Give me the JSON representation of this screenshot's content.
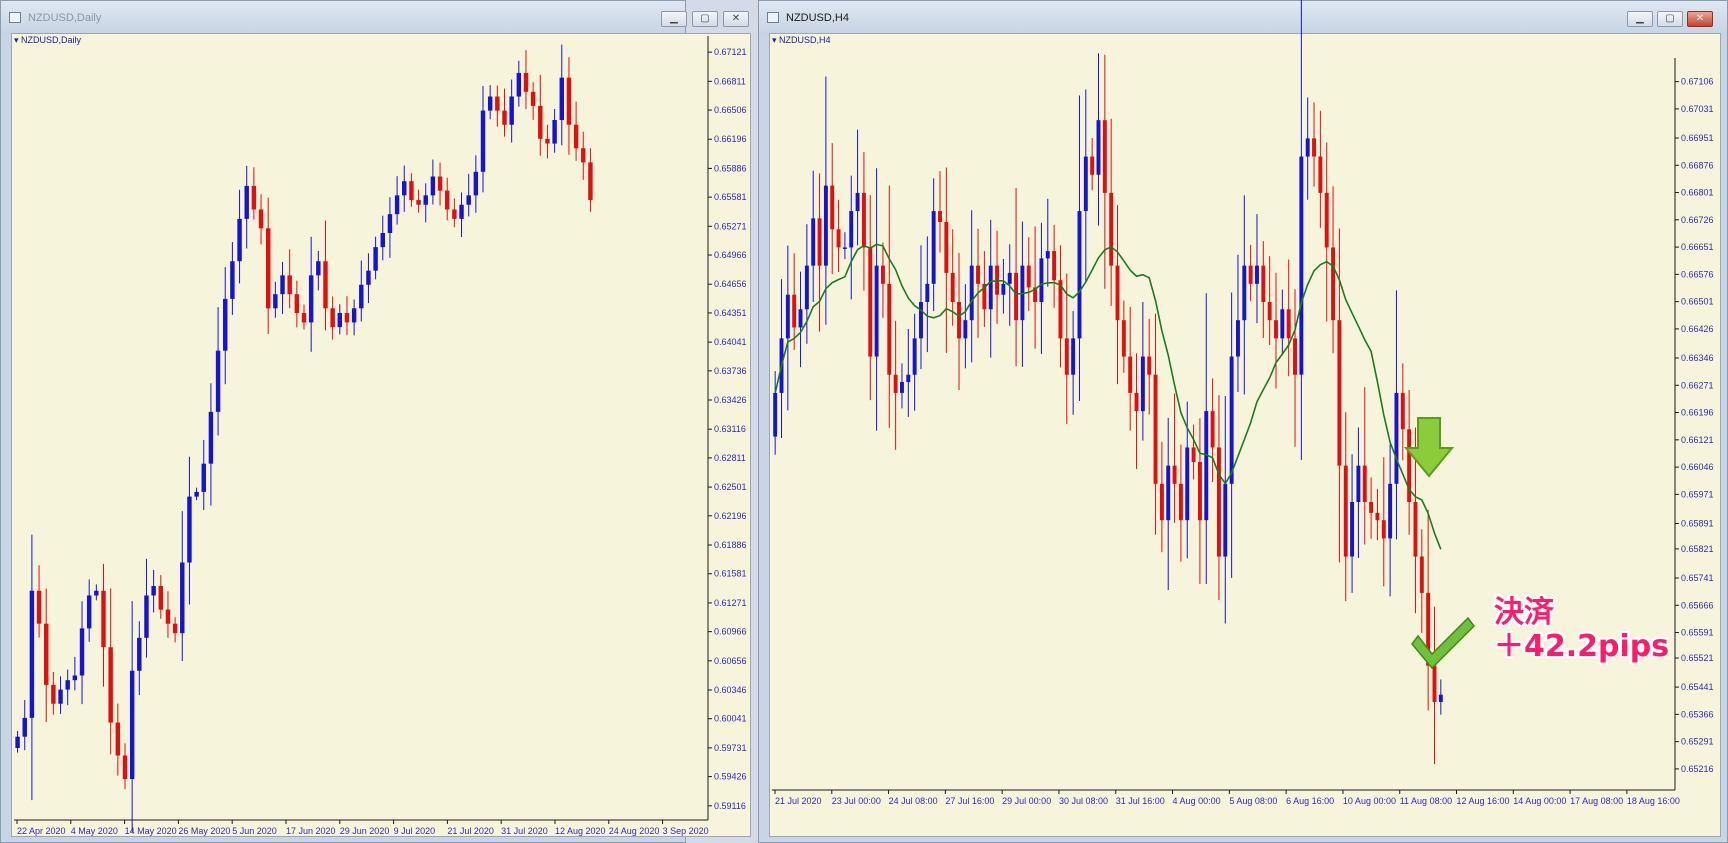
{
  "colors": {
    "bull": "#1515d0",
    "bear": "#e01010",
    "ma": "#1e7a1e",
    "axis_text": "#2b2bb8",
    "bg": "#f7f4dc"
  },
  "left_window": {
    "title": "NZDUSD,Daily",
    "chart_label": "NZDUSD,Daily",
    "controls": [
      "minimize",
      "maximize",
      "close"
    ]
  },
  "right_window": {
    "title": "NZDUSD,H4",
    "chart_label": "NZDUSD,H4",
    "controls": [
      "minimize",
      "maximize",
      "close"
    ]
  },
  "annotation": {
    "line1": "決済",
    "line2": "＋42.2pips"
  },
  "chart_data": [
    {
      "type": "candlestick",
      "symbol": "NZDUSD",
      "timeframe": "Daily",
      "y_ticks": [
        "0.67121",
        "0.66811",
        "0.66506",
        "0.66196",
        "0.65886",
        "0.65581",
        "0.65271",
        "0.64966",
        "0.64656",
        "0.64351",
        "0.64041",
        "0.63736",
        "0.63426",
        "0.63116",
        "0.62811",
        "0.62501",
        "0.62196",
        "0.61886",
        "0.61581",
        "0.61271",
        "0.60966",
        "0.60656",
        "0.60346",
        "0.60041",
        "0.59731",
        "0.59426",
        "0.59116"
      ],
      "x_ticks": [
        "22 Apr 2020",
        "4 May 2020",
        "14 May 2020",
        "26 May 2020",
        "5 Jun 2020",
        "17 Jun 2020",
        "29 Jun 2020",
        "9 Jul 2020",
        "21 Jul 2020",
        "31 Jul 2020",
        "12 Aug 2020",
        "24 Aug 2020",
        "3 Sep 2020"
      ],
      "ylim": [
        0.5905,
        0.6725
      ],
      "close_path": [
        0.5985,
        0.6005,
        0.614,
        0.6105,
        0.604,
        0.602,
        0.6035,
        0.6045,
        0.605,
        0.61,
        0.6135,
        0.614,
        0.608,
        0.6,
        0.5965,
        0.594,
        0.6055,
        0.609,
        0.6135,
        0.6145,
        0.612,
        0.6105,
        0.6095,
        0.617,
        0.624,
        0.6245,
        0.6275,
        0.633,
        0.6395,
        0.645,
        0.649,
        0.6535,
        0.657,
        0.6545,
        0.6525,
        0.644,
        0.6455,
        0.6475,
        0.6455,
        0.6435,
        0.6425,
        0.6475,
        0.649,
        0.644,
        0.642,
        0.6435,
        0.6425,
        0.644,
        0.6465,
        0.648,
        0.6505,
        0.652,
        0.654,
        0.656,
        0.6575,
        0.6555,
        0.655,
        0.656,
        0.658,
        0.6565,
        0.6545,
        0.6535,
        0.655,
        0.656,
        0.6585,
        0.665,
        0.6665,
        0.665,
        0.6635,
        0.6665,
        0.669,
        0.667,
        0.6655,
        0.662,
        0.6615,
        0.664,
        0.6685,
        0.6635,
        0.661,
        0.6595,
        0.6555
      ]
    },
    {
      "type": "candlestick",
      "symbol": "NZDUSD",
      "timeframe": "H4",
      "y_ticks": [
        "0.67106",
        "0.67031",
        "0.66951",
        "0.66876",
        "0.66801",
        "0.66726",
        "0.66651",
        "0.66576",
        "0.66501",
        "0.66426",
        "0.66346",
        "0.66271",
        "0.66196",
        "0.66121",
        "0.66046",
        "0.65971",
        "0.65891",
        "0.65821",
        "0.65741",
        "0.65666",
        "0.65591",
        "0.65521",
        "0.65441",
        "0.65366",
        "0.65291",
        "0.65216"
      ],
      "x_ticks": [
        "21 Jul 2020",
        "23 Jul 00:00",
        "24 Jul 08:00",
        "27 Jul 16:00",
        "29 Jul 00:00",
        "30 Jul 08:00",
        "31 Jul 16:00",
        "4 Aug 00:00",
        "5 Aug 08:00",
        "6 Aug 16:00",
        "10 Aug 00:00",
        "11 Aug 08:00",
        "12 Aug 16:00",
        "14 Aug 00:00",
        "17 Aug 08:00",
        "18 Aug 16:00"
      ],
      "ylim": [
        0.6518,
        0.6716
      ],
      "close_path": [
        0.6625,
        0.664,
        0.6652,
        0.6643,
        0.6648,
        0.666,
        0.6673,
        0.666,
        0.6682,
        0.667,
        0.6665,
        0.6665,
        0.6675,
        0.668,
        0.6665,
        0.6635,
        0.666,
        0.6655,
        0.663,
        0.6625,
        0.6628,
        0.663,
        0.664,
        0.665,
        0.6655,
        0.6675,
        0.6672,
        0.6658,
        0.665,
        0.664,
        0.6645,
        0.666,
        0.6655,
        0.6648,
        0.666,
        0.6652,
        0.6655,
        0.6658,
        0.6645,
        0.666,
        0.6654,
        0.665,
        0.6662,
        0.6664,
        0.6656,
        0.664,
        0.663,
        0.664,
        0.6675,
        0.669,
        0.6685,
        0.67,
        0.668,
        0.666,
        0.6645,
        0.6635,
        0.6625,
        0.662,
        0.6635,
        0.663,
        0.66,
        0.659,
        0.6605,
        0.66,
        0.659,
        0.661,
        0.6606,
        0.659,
        0.662,
        0.661,
        0.658,
        0.66,
        0.6635,
        0.6645,
        0.666,
        0.6655,
        0.666,
        0.665,
        0.6645,
        0.664,
        0.6648,
        0.664,
        0.663,
        0.669,
        0.6695,
        0.669,
        0.668,
        0.6665,
        0.6645,
        0.6605,
        0.658,
        0.6595,
        0.6605,
        0.6595,
        0.6592,
        0.659,
        0.6585,
        0.66,
        0.6625,
        0.6615,
        0.6595,
        0.658,
        0.657,
        0.655,
        0.654,
        0.6542
      ]
    }
  ]
}
